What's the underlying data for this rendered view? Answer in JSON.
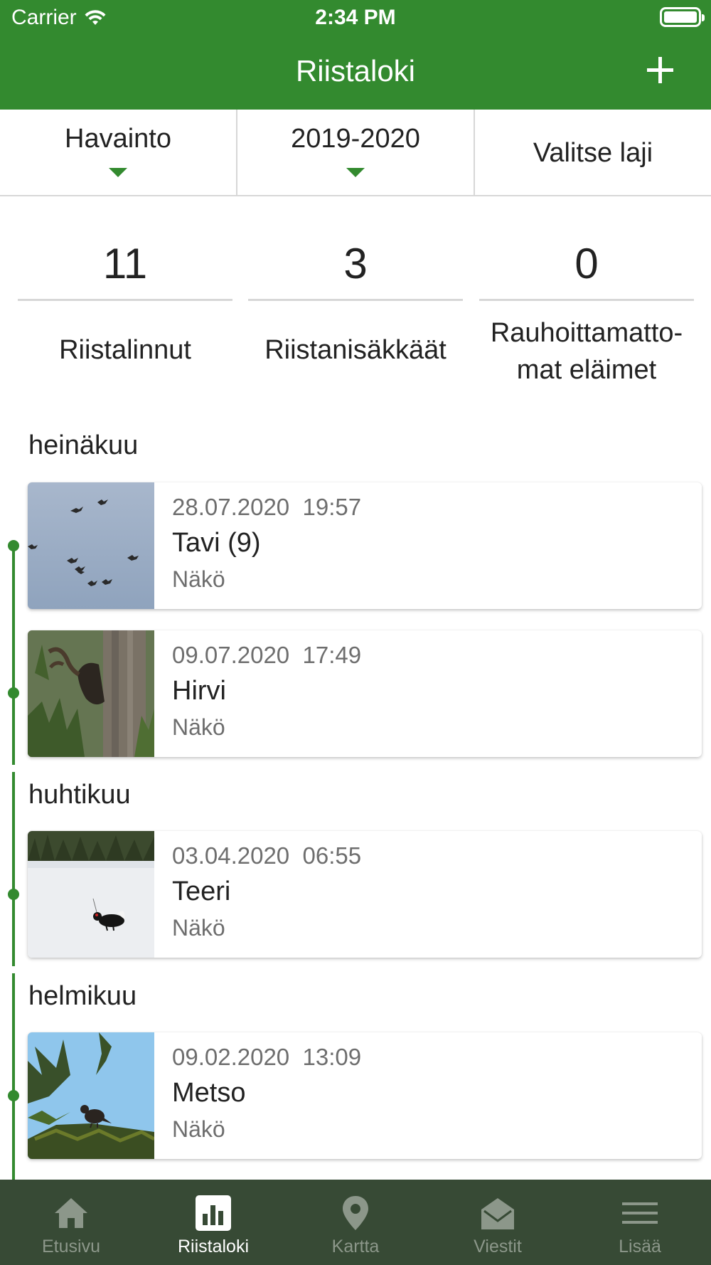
{
  "status_bar": {
    "carrier": "Carrier",
    "time": "2:34 PM"
  },
  "nav": {
    "title": "Riistaloki",
    "add_icon": "plus-icon"
  },
  "filters": [
    {
      "label": "Havainto",
      "dropdown": true
    },
    {
      "label": "2019-2020",
      "dropdown": true
    },
    {
      "label": "Valitse laji",
      "dropdown": false
    }
  ],
  "counters": [
    {
      "value": "11",
      "label": "Riistalinnut"
    },
    {
      "value": "3",
      "label": "Riistanisäkkäät"
    },
    {
      "value": "0",
      "label": "Rauhoittamatto-\nmat eläimet"
    }
  ],
  "months": [
    {
      "name": "heinäkuu"
    },
    {
      "name": "huhtikuu"
    },
    {
      "name": "helmikuu"
    }
  ],
  "entries": [
    {
      "date": "28.07.2020  19:57",
      "title": "Tavi (9)",
      "sub": "Näkö",
      "image": "flying-ducks-photo"
    },
    {
      "date": "09.07.2020  17:49",
      "title": "Hirvi",
      "sub": "Näkö",
      "image": "moose-forest-photo"
    },
    {
      "date": "03.04.2020  06:55",
      "title": "Teeri",
      "sub": "Näkö",
      "image": "black-grouse-snow-photo"
    },
    {
      "date": "09.02.2020  13:09",
      "title": "Metso",
      "sub": "Näkö",
      "image": "capercaillie-tree-photo"
    }
  ],
  "tabs": [
    {
      "label": "Etusivu",
      "icon": "home-icon",
      "active": false
    },
    {
      "label": "Riistaloki",
      "icon": "chart-icon",
      "active": true
    },
    {
      "label": "Kartta",
      "icon": "map-pin-icon",
      "active": false
    },
    {
      "label": "Viestit",
      "icon": "envelope-icon",
      "active": false
    },
    {
      "label": "Lisää",
      "icon": "menu-icon",
      "active": false
    }
  ],
  "colors": {
    "primary": "#338a2f",
    "tabbar": "#374a35",
    "tab_inactive": "#8c978a",
    "tab_active": "#ffffff"
  }
}
